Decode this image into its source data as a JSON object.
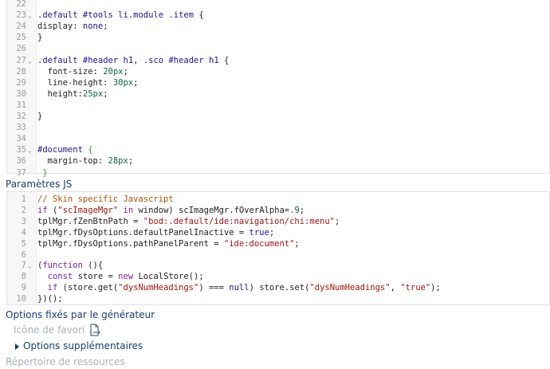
{
  "css_editor": {
    "lines": [
      {
        "n": "22",
        "fold": false,
        "tokens": []
      },
      {
        "n": "23",
        "fold": true,
        "tokens": [
          {
            "c": "val",
            "t": ".default"
          },
          {
            "c": "plain",
            "t": " "
          },
          {
            "c": "val",
            "t": "#tools"
          },
          {
            "c": "plain",
            "t": " "
          },
          {
            "c": "val",
            "t": "li"
          },
          {
            "c": "val",
            "t": ".module"
          },
          {
            "c": "plain",
            "t": " "
          },
          {
            "c": "val",
            "t": ".item"
          },
          {
            "c": "plain",
            "t": " {"
          }
        ]
      },
      {
        "n": "24",
        "fold": false,
        "tokens": [
          {
            "c": "plain",
            "t": "display: "
          },
          {
            "c": "val",
            "t": "none"
          },
          {
            "c": "plain",
            "t": ";"
          }
        ]
      },
      {
        "n": "25",
        "fold": false,
        "tokens": [
          {
            "c": "plain",
            "t": "}"
          }
        ]
      },
      {
        "n": "26",
        "fold": false,
        "tokens": []
      },
      {
        "n": "27",
        "fold": true,
        "tokens": [
          {
            "c": "val",
            "t": ".default"
          },
          {
            "c": "plain",
            "t": " "
          },
          {
            "c": "val",
            "t": "#header"
          },
          {
            "c": "plain",
            "t": " "
          },
          {
            "c": "val",
            "t": "h1"
          },
          {
            "c": "plain",
            "t": ", "
          },
          {
            "c": "val",
            "t": ".sco"
          },
          {
            "c": "plain",
            "t": " "
          },
          {
            "c": "val",
            "t": "#header"
          },
          {
            "c": "plain",
            "t": " "
          },
          {
            "c": "val",
            "t": "h1"
          },
          {
            "c": "plain",
            "t": " {"
          }
        ]
      },
      {
        "n": "28",
        "fold": false,
        "tokens": [
          {
            "c": "plain",
            "t": "  font-size: "
          },
          {
            "c": "num",
            "t": "20px"
          },
          {
            "c": "plain",
            "t": ";"
          }
        ]
      },
      {
        "n": "29",
        "fold": false,
        "tokens": [
          {
            "c": "plain",
            "t": "  line-height: "
          },
          {
            "c": "num",
            "t": "30px"
          },
          {
            "c": "plain",
            "t": ";"
          }
        ]
      },
      {
        "n": "30",
        "fold": false,
        "tokens": [
          {
            "c": "plain",
            "t": "  height:"
          },
          {
            "c": "num",
            "t": "25px"
          },
          {
            "c": "plain",
            "t": ";"
          }
        ]
      },
      {
        "n": "31",
        "fold": false,
        "tokens": []
      },
      {
        "n": "32",
        "fold": false,
        "tokens": [
          {
            "c": "plain",
            "t": "}"
          }
        ]
      },
      {
        "n": "33",
        "fold": false,
        "tokens": []
      },
      {
        "n": "34",
        "fold": false,
        "tokens": []
      },
      {
        "n": "35",
        "fold": true,
        "tokens": [
          {
            "c": "val",
            "t": "#document"
          },
          {
            "c": "plain",
            "t": " "
          },
          {
            "c": "brk",
            "t": "{"
          }
        ]
      },
      {
        "n": "36",
        "fold": false,
        "tokens": [
          {
            "c": "plain",
            "t": "  margin-top: "
          },
          {
            "c": "num",
            "t": "28px"
          },
          {
            "c": "plain",
            "t": ";"
          }
        ]
      },
      {
        "n": "37",
        "fold": false,
        "tokens": [
          {
            "c": "plain",
            "t": " "
          },
          {
            "c": "brk",
            "t": "}"
          }
        ]
      }
    ]
  },
  "js_section_label": "Paramètres JS",
  "js_editor": {
    "lines": [
      {
        "n": "1",
        "fold": false,
        "tokens": [
          {
            "c": "com",
            "t": "// Skin specific Javascript"
          }
        ]
      },
      {
        "n": "2",
        "fold": false,
        "tokens": [
          {
            "c": "kw",
            "t": "if"
          },
          {
            "c": "plain",
            "t": " ("
          },
          {
            "c": "str",
            "t": "\"scImageMgr\""
          },
          {
            "c": "plain",
            "t": " "
          },
          {
            "c": "kw",
            "t": "in"
          },
          {
            "c": "plain",
            "t": " window) scImageMgr.fOverAlpha="
          },
          {
            "c": "num",
            "t": ".9"
          },
          {
            "c": "plain",
            "t": ";"
          }
        ]
      },
      {
        "n": "3",
        "fold": false,
        "tokens": [
          {
            "c": "plain",
            "t": "tplMgr.fZenBtnPath = "
          },
          {
            "c": "str",
            "t": "\"bod:.default/ide:navigation/chi:menu\""
          },
          {
            "c": "plain",
            "t": ";"
          }
        ]
      },
      {
        "n": "4",
        "fold": false,
        "tokens": [
          {
            "c": "plain",
            "t": "tplMgr.fDysOptions.defaultPanelInactive = "
          },
          {
            "c": "val",
            "t": "true"
          },
          {
            "c": "plain",
            "t": ";"
          }
        ]
      },
      {
        "n": "5",
        "fold": false,
        "tokens": [
          {
            "c": "plain",
            "t": "tplMgr.fDysOptions.pathPanelParent = "
          },
          {
            "c": "str",
            "t": "\"ide:document\""
          },
          {
            "c": "plain",
            "t": ";"
          }
        ]
      },
      {
        "n": "6",
        "fold": false,
        "tokens": []
      },
      {
        "n": "7",
        "fold": true,
        "tokens": [
          {
            "c": "plain",
            "t": "("
          },
          {
            "c": "kw",
            "t": "function"
          },
          {
            "c": "plain",
            "t": " (){"
          }
        ]
      },
      {
        "n": "8",
        "fold": false,
        "tokens": [
          {
            "c": "plain",
            "t": "  "
          },
          {
            "c": "kw",
            "t": "const"
          },
          {
            "c": "plain",
            "t": " store = "
          },
          {
            "c": "kw",
            "t": "new"
          },
          {
            "c": "plain",
            "t": " LocalStore();"
          }
        ]
      },
      {
        "n": "9",
        "fold": false,
        "tokens": [
          {
            "c": "plain",
            "t": "  "
          },
          {
            "c": "kw",
            "t": "if"
          },
          {
            "c": "plain",
            "t": " (store.get("
          },
          {
            "c": "str",
            "t": "\"dysNumHeadings\""
          },
          {
            "c": "plain",
            "t": ") === "
          },
          {
            "c": "val",
            "t": "null"
          },
          {
            "c": "plain",
            "t": ") store.set("
          },
          {
            "c": "str",
            "t": "\"dysNumHeadings\""
          },
          {
            "c": "plain",
            "t": ", "
          },
          {
            "c": "str",
            "t": "\"true\""
          },
          {
            "c": "plain",
            "t": ");"
          }
        ]
      },
      {
        "n": "10",
        "fold": false,
        "tokens": [
          {
            "c": "plain",
            "t": "})();"
          }
        ]
      }
    ]
  },
  "generator_options_label": "Options fixés par le générateur",
  "favicon_label": "Icône de favori",
  "favicon_icon": "file-export-icon",
  "extra_options_label": "Options supplémentaires",
  "resources_label": "Répertoire de ressources"
}
